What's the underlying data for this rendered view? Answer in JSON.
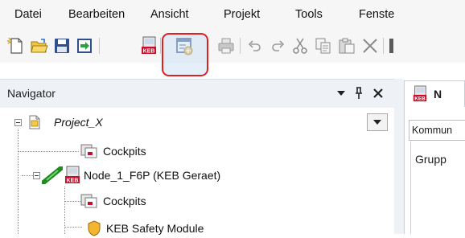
{
  "menu": {
    "items": [
      {
        "key": "datei",
        "label": "Datei"
      },
      {
        "key": "bearbeiten",
        "label": "Bearbeiten"
      },
      {
        "key": "ansicht",
        "label": "Ansicht"
      },
      {
        "key": "projekt",
        "label": "Projekt"
      },
      {
        "key": "tools",
        "label": "Tools"
      },
      {
        "key": "fenster",
        "label": "Fenste"
      }
    ]
  },
  "toolbar": {
    "buttons": [
      {
        "name": "new-project-icon"
      },
      {
        "name": "open-folder-icon"
      },
      {
        "name": "save-icon"
      },
      {
        "name": "import-icon"
      },
      {
        "name": "keb-device-icon"
      },
      {
        "name": "add-cockpit-icon",
        "highlighted": true
      },
      {
        "name": "print-icon"
      },
      {
        "name": "undo-icon"
      },
      {
        "name": "redo-icon"
      },
      {
        "name": "cut-icon"
      },
      {
        "name": "copy-icon"
      },
      {
        "name": "paste-icon"
      },
      {
        "name": "delete-icon"
      }
    ],
    "highlight_color": "#e02020"
  },
  "navigator": {
    "title": "Navigator",
    "tree": [
      {
        "label": "Project_X",
        "italic": true,
        "icon": "project-icon"
      },
      {
        "label": "Cockpits",
        "icon": "cockpit-icon"
      },
      {
        "label": "Node_1_F6P (KEB Geraet)",
        "icon": "keb-device-icon"
      },
      {
        "label": "Cockpits",
        "icon": "cockpit-icon"
      },
      {
        "label": "KEB Safety Module",
        "icon": "shield-icon"
      }
    ]
  },
  "editor": {
    "tab_label": "N",
    "subtab_label": "Kommun",
    "group_label": "Grupp"
  },
  "colors": {
    "keb_red": "#c8102e",
    "node_green": "#2fa32f",
    "panel_header": "#eef1f6"
  }
}
